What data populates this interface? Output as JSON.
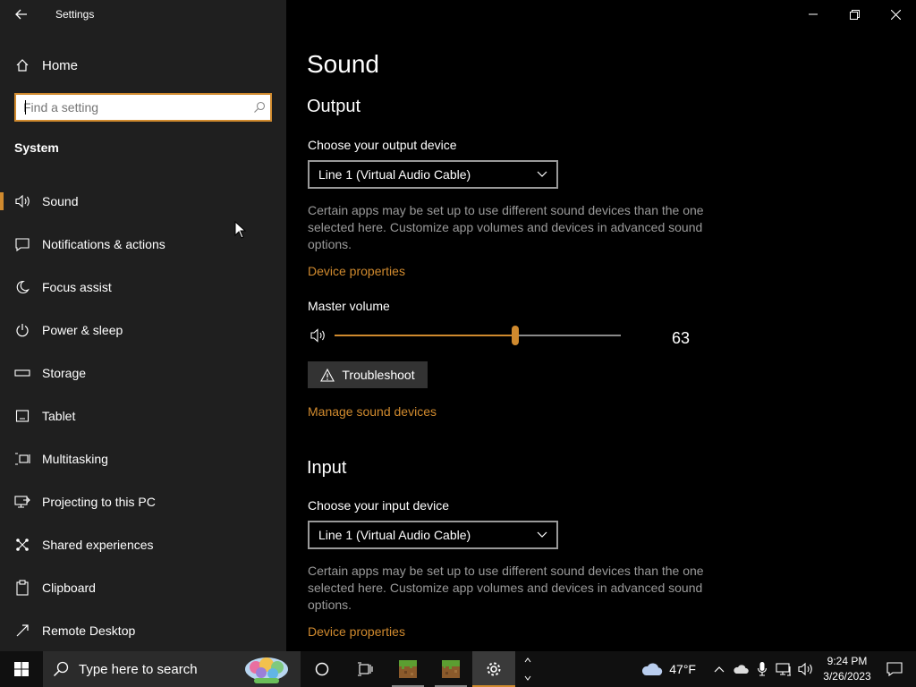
{
  "window": {
    "title": "Settings"
  },
  "sidebar": {
    "home_label": "Home",
    "search_placeholder": "Find a setting",
    "section": "System",
    "items": [
      {
        "label": "Sound",
        "icon": "speaker-icon",
        "active": true
      },
      {
        "label": "Notifications & actions",
        "icon": "message-icon"
      },
      {
        "label": "Focus assist",
        "icon": "moon-icon"
      },
      {
        "label": "Power & sleep",
        "icon": "power-icon"
      },
      {
        "label": "Storage",
        "icon": "storage-icon"
      },
      {
        "label": "Tablet",
        "icon": "tablet-icon"
      },
      {
        "label": "Multitasking",
        "icon": "multitasking-icon"
      },
      {
        "label": "Projecting to this PC",
        "icon": "projecting-icon"
      },
      {
        "label": "Shared experiences",
        "icon": "shared-icon"
      },
      {
        "label": "Clipboard",
        "icon": "clipboard-icon"
      },
      {
        "label": "Remote Desktop",
        "icon": "remote-desktop-icon"
      }
    ]
  },
  "main": {
    "title": "Sound",
    "output": {
      "heading": "Output",
      "device_label": "Choose your output device",
      "device_value": "Line 1 (Virtual Audio Cable)",
      "description": "Certain apps may be set up to use different sound devices than the one selected here. Customize app volumes and devices in advanced sound options.",
      "device_properties": "Device properties",
      "master_volume_label": "Master volume",
      "master_volume": 63,
      "troubleshoot": "Troubleshoot",
      "manage_devices": "Manage sound devices"
    },
    "input": {
      "heading": "Input",
      "device_label": "Choose your input device",
      "device_value": "Line 1 (Virtual Audio Cable)",
      "description": "Certain apps may be set up to use different sound devices than the one selected here. Customize app volumes and devices in advanced sound options.",
      "device_properties": "Device properties"
    }
  },
  "taskbar": {
    "search_placeholder": "Type here to search",
    "weather_temp": "47°F",
    "time": "9:24 PM",
    "date": "3/26/2023"
  },
  "colors": {
    "accent": "#d08a2e",
    "sidebar_bg": "#1f1f1f",
    "main_bg": "#000000",
    "taskbar_bg": "#101010"
  }
}
